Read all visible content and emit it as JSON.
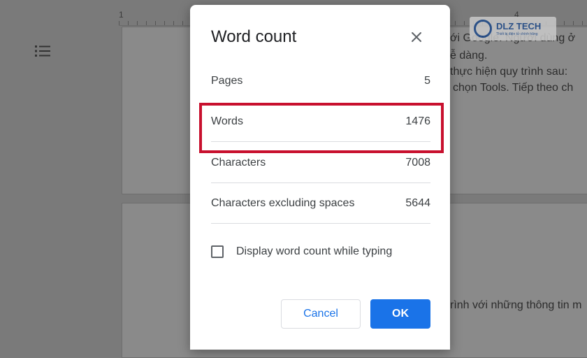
{
  "ruler": {
    "marks": [
      "1",
      "4"
    ]
  },
  "background_doc": {
    "lines": [
      "ới Google. Người dùng ở",
      "ễ dàng.",
      "thực hiện quy trình sau:",
      "chọn Tools. Tiếp theo ch",
      "rình với những thông tin m"
    ]
  },
  "logo": {
    "brand": "DLZ TECH",
    "tagline": "Thiết bị điện tử chính hãng"
  },
  "dialog": {
    "title": "Word count",
    "stats": [
      {
        "label": "Pages",
        "value": "5"
      },
      {
        "label": "Words",
        "value": "1476"
      },
      {
        "label": "Characters",
        "value": "7008"
      },
      {
        "label": "Characters excluding spaces",
        "value": "5644"
      }
    ],
    "checkbox_label": "Display word count while typing",
    "checkbox_checked": false,
    "cancel_label": "Cancel",
    "ok_label": "OK"
  },
  "colors": {
    "primary": "#1a73e8",
    "highlight": "#c8102e",
    "overlay": "#7a7a7a"
  }
}
